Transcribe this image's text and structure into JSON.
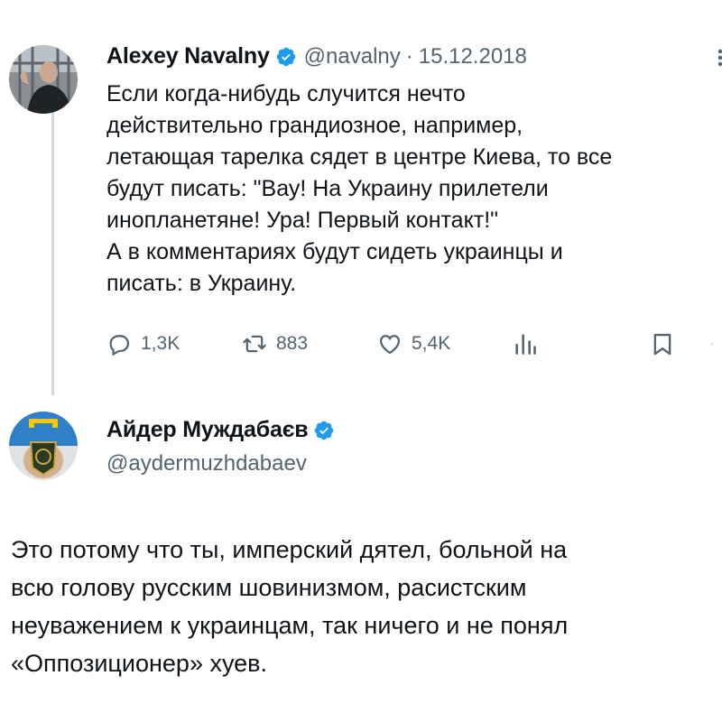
{
  "colors": {
    "verified": "#1d9bf0",
    "secondary_text": "#536471",
    "thread_line": "#cfd9de"
  },
  "original_tweet": {
    "author_name": "Alexey Navalny",
    "handle": "@navalny",
    "separator": "·",
    "date": "15.12.2018",
    "text": "Если когда-нибудь случится нечто\nдействительно грандиозное, например,\nлетающая тарелка сядет в центре Киева, то все\nбудут писать: \"Вау! На Украину прилетели\nинопланетяне! Ура! Первый контакт!\"\nА в комментариях будут сидеть украинцы и\nписать: в Украину.",
    "actions": {
      "replies": "1,3K",
      "retweets": "883",
      "likes": "5,4K"
    },
    "icons": [
      "reply-icon",
      "retweet-icon",
      "like-icon",
      "views-icon",
      "bookmark-icon",
      "share-icon",
      "more-icon"
    ]
  },
  "reply_tweet": {
    "author_name": "Айдер Муждабаєв",
    "handle": "@aydermuzhdabaev",
    "text": "Это потому что ты, имперский дятел, больной на\nвсю голову русским шовинизмом, расистским\nнеуважением к украинцам, так ничего и не понял\n«Оппозиционер» хуев."
  }
}
